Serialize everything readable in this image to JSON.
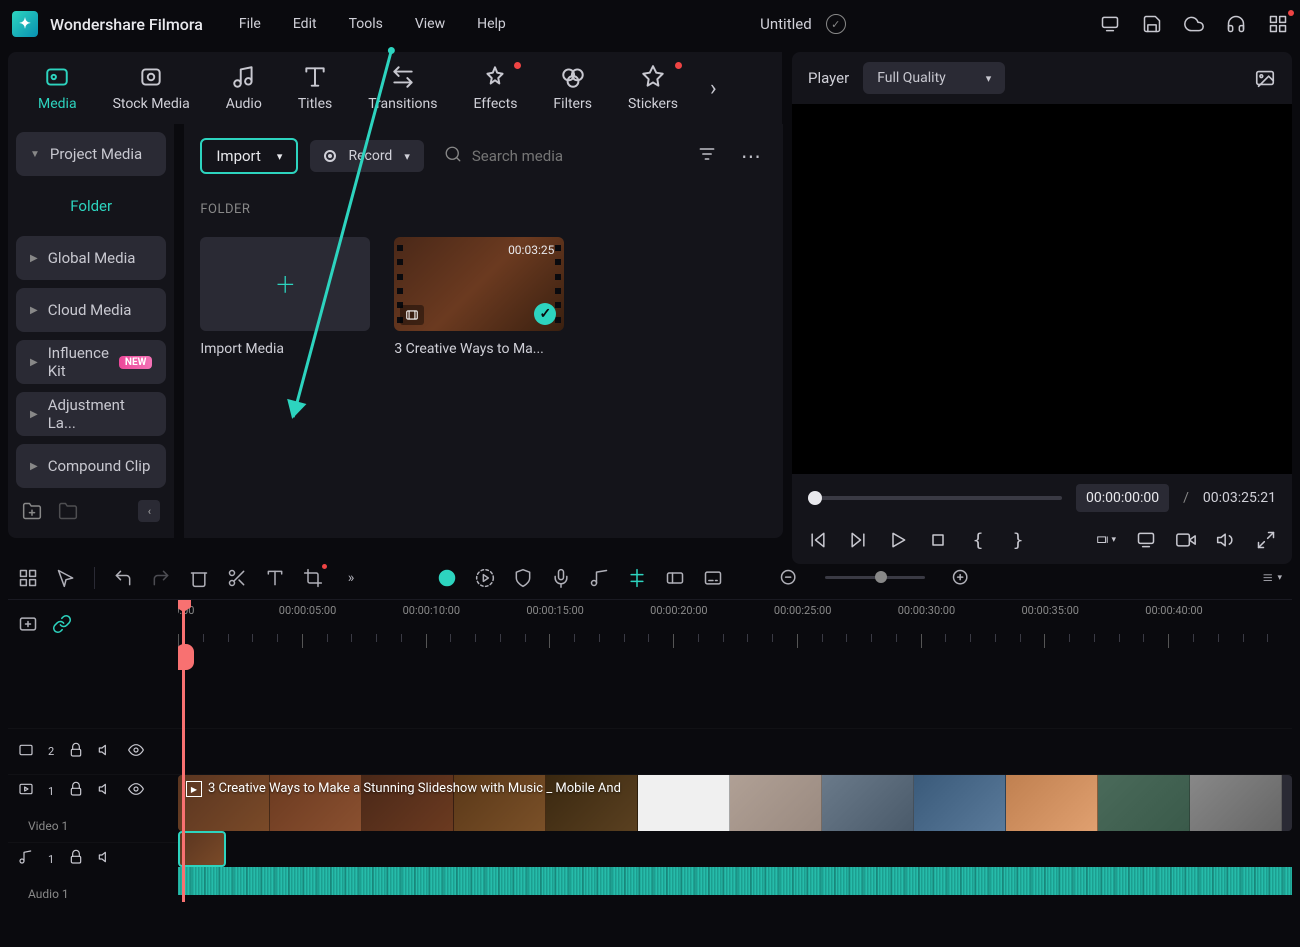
{
  "app": {
    "name": "Wondershare Filmora",
    "doc_title": "Untitled"
  },
  "menu": [
    "File",
    "Edit",
    "Tools",
    "View",
    "Help"
  ],
  "tabs": [
    {
      "label": "Media",
      "active": true
    },
    {
      "label": "Stock Media"
    },
    {
      "label": "Audio"
    },
    {
      "label": "Titles"
    },
    {
      "label": "Transitions"
    },
    {
      "label": "Effects",
      "dot": true
    },
    {
      "label": "Filters"
    },
    {
      "label": "Stickers",
      "dot": true
    }
  ],
  "sidebar": {
    "project_media": "Project Media",
    "folder": "Folder",
    "items": [
      "Global Media",
      "Cloud Media",
      "Influence Kit",
      "Adjustment La...",
      "Compound Clip"
    ],
    "new_badge": "NEW"
  },
  "center": {
    "import_label": "Import",
    "record_label": "Record",
    "search_placeholder": "Search media",
    "section": "FOLDER",
    "import_card": "Import Media",
    "clip": {
      "label": "3 Creative Ways to Ma...",
      "duration": "00:03:25"
    }
  },
  "player": {
    "label": "Player",
    "quality": "Full Quality",
    "time_current": "00:00:00:00",
    "time_total": "00:03:25:21"
  },
  "ruler": [
    "00:00",
    "00:00:05:00",
    "00:00:10:00",
    "00:00:15:00",
    "00:00:20:00",
    "00:00:25:00",
    "00:00:30:00",
    "00:00:35:00",
    "00:00:40:00"
  ],
  "tracks": {
    "v2_count": "2",
    "v1_count": "1",
    "v1_label": "Video 1",
    "a1_count": "1",
    "a1_label": "Audio 1",
    "clip_title": "3 Creative Ways to Make a Stunning Slideshow with Music _ Mobile And"
  }
}
